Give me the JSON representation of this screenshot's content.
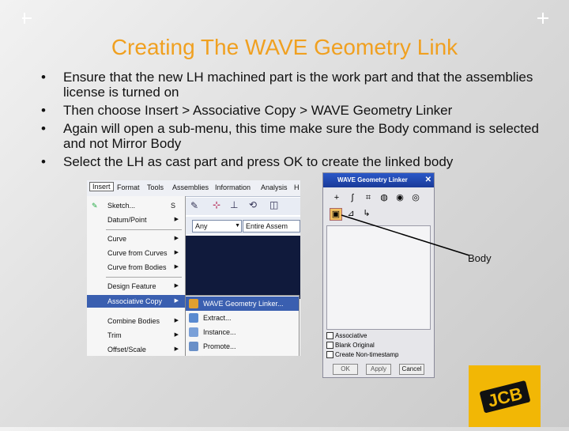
{
  "slide": {
    "title": "Creating The WAVE Geometry Link",
    "bullets": [
      "Ensure that the new LH machined part is the work part and that the assemblies license is turned on",
      "Then choose Insert > Associative Copy > WAVE Geometry Linker",
      "Again will open a sub-menu, this time make sure the Body command is selected and not Mirror Body",
      "Select the LH as cast part and press OK to create the linked body"
    ],
    "bullet_glyph": "•",
    "annotation": "Body",
    "title_color": "#f0a020"
  },
  "menubar": [
    "Insert",
    "Format",
    "Tools",
    "Assemblies",
    "Information",
    "Analysis",
    "H"
  ],
  "toolbar": {
    "filter_value": "Any",
    "scope_value": "Entire Assem"
  },
  "insert_menu": {
    "items": [
      {
        "label": "Sketch...",
        "shortcut": "S",
        "has_sub": false
      },
      {
        "label": "Datum/Point",
        "has_sub": true
      },
      {
        "label": "Curve",
        "has_sub": true
      },
      {
        "label": "Curve from Curves",
        "has_sub": true
      },
      {
        "label": "Curve from Bodies",
        "has_sub": true
      },
      {
        "label": "Design Feature",
        "has_sub": true
      },
      {
        "label": "Associative Copy",
        "has_sub": true,
        "highlighted": true
      },
      {
        "label": "Combine Bodies",
        "has_sub": true
      },
      {
        "label": "Trim",
        "has_sub": true
      },
      {
        "label": "Offset/Scale",
        "has_sub": true
      }
    ]
  },
  "submenu": {
    "items": [
      {
        "label": "WAVE Geometry Linker...",
        "highlighted": true
      },
      {
        "label": "Extract..."
      },
      {
        "label": "Instance..."
      },
      {
        "label": "Promote..."
      }
    ]
  },
  "dialog": {
    "title": "WAVE Geometry Linker",
    "checkboxes": [
      "Associative",
      "Blank Original",
      "Create Non-timestamp"
    ],
    "buttons": [
      "OK",
      "Apply",
      "Cancel"
    ]
  },
  "logo": {
    "text": "JCB",
    "color": "#f2b705"
  }
}
